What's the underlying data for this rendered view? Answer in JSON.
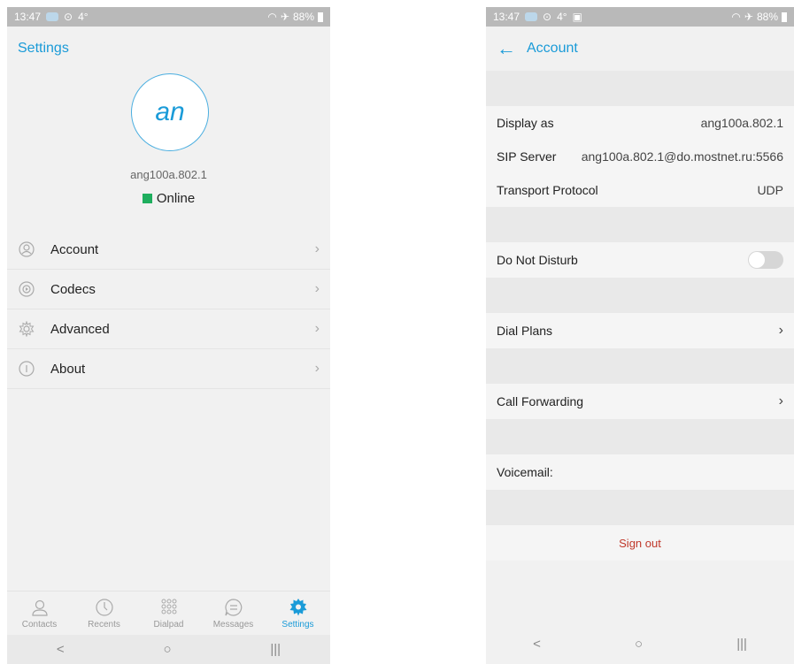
{
  "status_bar": {
    "time": "13:47",
    "extra": "4°",
    "battery": "88%"
  },
  "left": {
    "header_title": "Settings",
    "avatar_initials": "an",
    "account_name": "ang100a.802.1",
    "presence": "Online",
    "presence_color": "#1fae5e",
    "menu": [
      {
        "label": "Account",
        "icon": "person-icon"
      },
      {
        "label": "Codecs",
        "icon": "codec-icon"
      },
      {
        "label": "Advanced",
        "icon": "gear-icon"
      },
      {
        "label": "About",
        "icon": "info-icon"
      }
    ],
    "tabs": [
      {
        "label": "Contacts",
        "icon": "contacts-icon"
      },
      {
        "label": "Recents",
        "icon": "clock-icon"
      },
      {
        "label": "Dialpad",
        "icon": "dialpad-icon"
      },
      {
        "label": "Messages",
        "icon": "message-icon"
      },
      {
        "label": "Settings",
        "icon": "settings-gear-icon",
        "active": true
      }
    ],
    "accent_color": "#1a9bd8"
  },
  "right": {
    "header_title": "Account",
    "display_as_label": "Display as",
    "display_as_value": "ang100a.802.1",
    "sip_server_label": "SIP Server",
    "sip_server_value": "ang100a.802.1@do.mostnet.ru:5566",
    "transport_label": "Transport Protocol",
    "transport_value": "UDP",
    "dnd_label": "Do Not Disturb",
    "dnd_enabled": false,
    "dial_plans_label": "Dial Plans",
    "call_forwarding_label": "Call Forwarding",
    "voicemail_label": "Voicemail:",
    "sign_out_label": "Sign out",
    "sign_out_color": "#c0392b"
  },
  "sys_nav": {
    "back": "<",
    "home": "○",
    "recents": "|||"
  }
}
